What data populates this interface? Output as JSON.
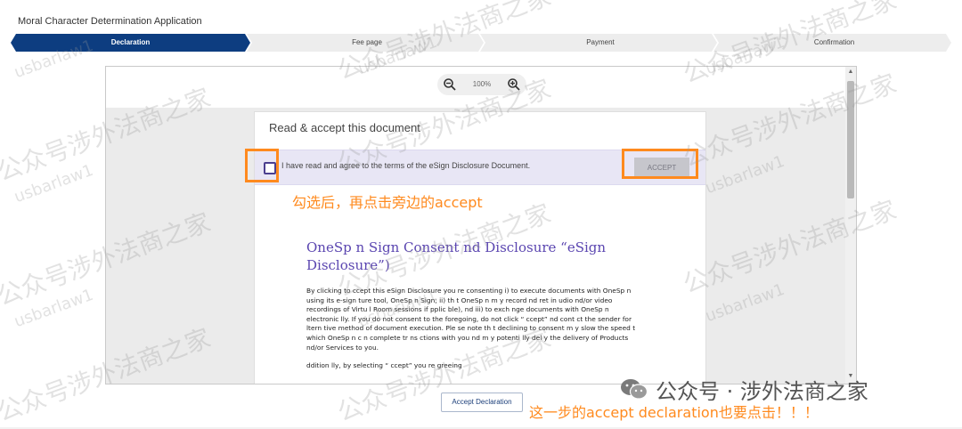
{
  "app": {
    "title": "Moral Character Determination Application"
  },
  "steps": [
    {
      "label": "Declaration",
      "active": true
    },
    {
      "label": "Fee page",
      "active": false
    },
    {
      "label": "Payment",
      "active": false
    },
    {
      "label": "Confirmation",
      "active": false
    }
  ],
  "viewer": {
    "zoom_level": "100%"
  },
  "document": {
    "card_title": "Read & accept this document",
    "consent_text": "I have read and agree to the terms of the eSign Disclosure Document.",
    "accept_label": "ACCEPT",
    "heading": "OneSp n Sign Consent nd Disclosure “eSign Disclosure”)",
    "paragraph1": "By clicking to ccept this eSign Disclosure you re consenting i) to execute documents with OneSp n using its e-sign ture tool, OneSp n Sign; ii) th t OneSp n m y record nd ret in udio nd/or video recordings of Virtu l Room sessions if pplic ble), nd iii) to exch nge documents with OneSp n electronic lly. If you do not consent to the foregoing, do not click “ ccept” nd cont ct the sender for ltern tive method of document execution. Ple se note th t declining to consent m y slow the speed t which OneSp n c n complete tr ns ctions with you nd m y potenti lly del y the delivery of Products nd/or Services to you.",
    "paragraph2": "ddition lly, by selecting “ ccept” you re greeing"
  },
  "annotations": {
    "checkbox_note": "勾选后，再点击旁边的accept",
    "declaration_note": "这一步的accept declaration也要点击！！！"
  },
  "footer": {
    "accept_declaration_label": "Accept Declaration"
  },
  "watermark": {
    "text_cn": "公众号涉外法商之家",
    "text_en": "usbarlaw1",
    "wechat_text": "公众号 · 涉外法商之家"
  },
  "colors": {
    "active_step": "#0d3d80",
    "inactive_step": "#ededed",
    "highlight": "#ff8a1e",
    "heading": "#5a45b0"
  }
}
